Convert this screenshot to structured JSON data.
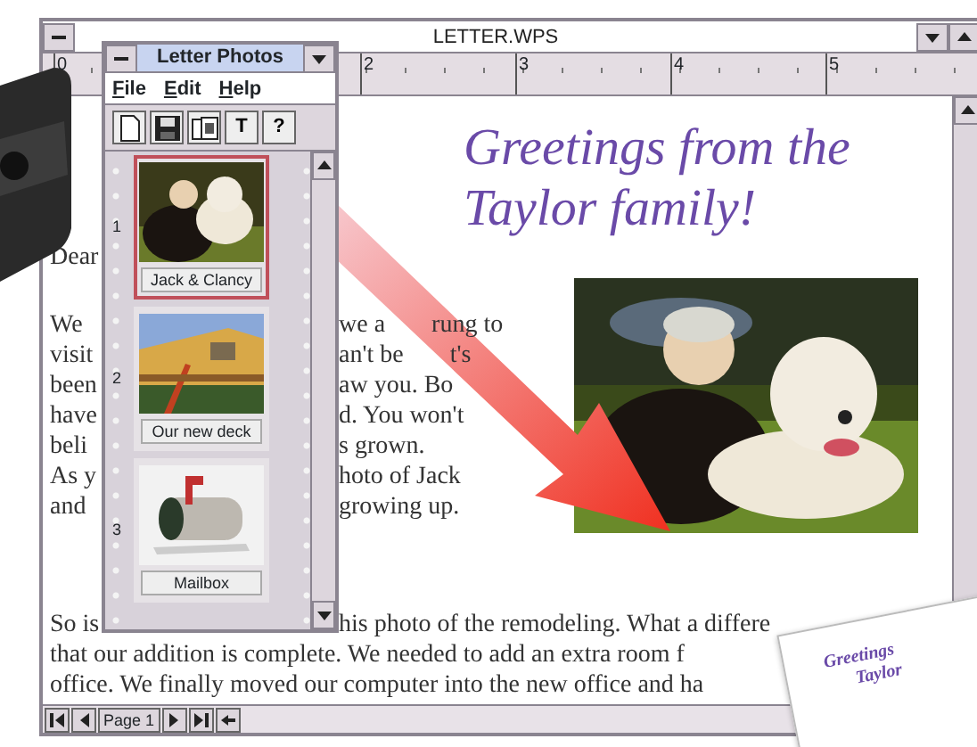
{
  "document": {
    "title": "LETTER.WPS",
    "ruler_marks": [
      "0",
      "2",
      "3",
      "4",
      "5"
    ],
    "heading_lines": [
      "Greetings from the",
      "Taylor family!"
    ],
    "salutation": "Dear",
    "lines": [
      {
        "left": "We",
        "right": [
          "we a",
          "rung to"
        ]
      },
      {
        "left": "visit",
        "right": [
          "an't be",
          "t's"
        ]
      },
      {
        "left": "been",
        "right": [
          "aw you. Bo"
        ]
      },
      {
        "left": "have",
        "right": [
          "d. You won't"
        ]
      },
      {
        "left": "beli",
        "right": [
          "s grown."
        ]
      },
      {
        "left": "As y",
        "right": [
          "hoto of Jack"
        ]
      },
      {
        "left": "and",
        "right": [
          "growing up."
        ]
      }
    ],
    "paragraph_lines": [
      {
        "left": "So is",
        "right": "his photo of the remodeling. What a differe"
      },
      {
        "right": "that our addition is complete. We needed to add an extra room f"
      },
      {
        "right": "office. We finally moved our computer into the new office and ha"
      }
    ],
    "photo": {
      "kind": "picture"
    }
  },
  "status_bar": {
    "page": "Page 1"
  },
  "palette": {
    "title": "Letter Photos",
    "menu": [
      "File",
      "Edit",
      "Help"
    ],
    "tools": [
      {
        "kind": "icon"
      },
      {
        "kind": "icon"
      },
      {
        "kind": "icon"
      },
      {
        "kind": "text",
        "label": "T"
      },
      {
        "kind": "text",
        "label": "?"
      }
    ],
    "photos": [
      {
        "number": "1",
        "caption": "Jack & Clancy",
        "selected": true
      },
      {
        "number": "2",
        "caption": "Our new deck",
        "selected": false
      },
      {
        "number": "3",
        "caption": "Mailbox",
        "selected": false
      }
    ]
  },
  "card": {
    "lines": [
      "Greetings",
      "Taylor"
    ]
  }
}
